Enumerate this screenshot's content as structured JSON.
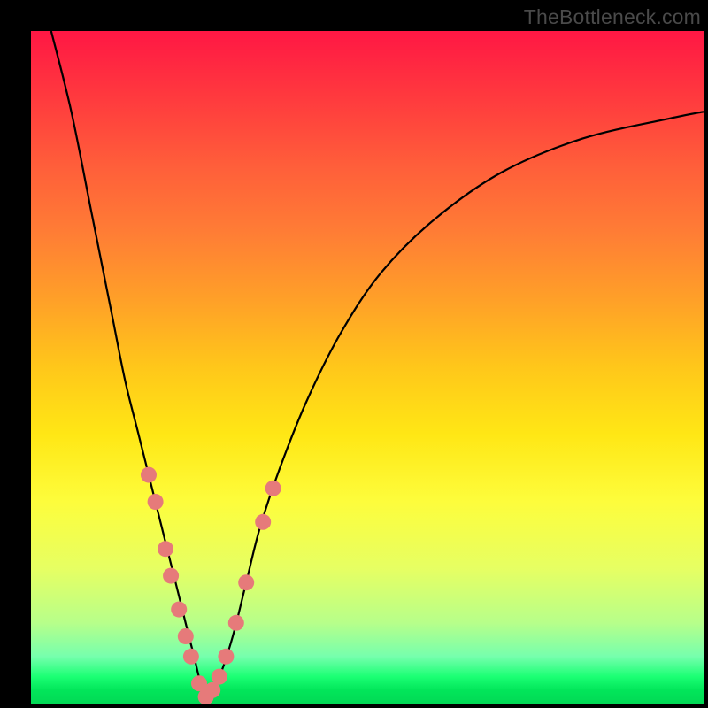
{
  "watermark": "TheBottleneck.com",
  "colors": {
    "frame": "#000000",
    "curve": "#000000",
    "dot": "#e67a7a",
    "gradient_top": "#ff1744",
    "gradient_bottom": "#02d955"
  },
  "chart_data": {
    "type": "line",
    "title": "",
    "xlabel": "",
    "ylabel": "",
    "xlim": [
      0,
      100
    ],
    "ylim": [
      0,
      100
    ],
    "note": "Bottleneck-style V-curve; y-axis = mismatch (% high=red top, 0=green bottom), x-axis = component balance. Minimum ~x=26. Pink dots mark sampled points along both flanks of the valley.",
    "series": [
      {
        "name": "bottleneck-curve",
        "x": [
          3,
          6,
          9,
          12,
          14,
          16,
          18,
          20,
          22,
          24,
          26,
          28,
          30,
          32,
          34,
          37,
          41,
          46,
          52,
          60,
          70,
          82,
          95,
          100
        ],
        "y": [
          100,
          88,
          73,
          58,
          48,
          40,
          32,
          24,
          16,
          8,
          1,
          4,
          10,
          18,
          26,
          35,
          45,
          55,
          64,
          72,
          79,
          84,
          87,
          88
        ]
      }
    ],
    "points": [
      {
        "x": 17.5,
        "y": 34
      },
      {
        "x": 18.5,
        "y": 30
      },
      {
        "x": 20.0,
        "y": 23
      },
      {
        "x": 20.8,
        "y": 19
      },
      {
        "x": 22.0,
        "y": 14
      },
      {
        "x": 23.0,
        "y": 10
      },
      {
        "x": 23.8,
        "y": 7
      },
      {
        "x": 25.0,
        "y": 3
      },
      {
        "x": 26.0,
        "y": 1
      },
      {
        "x": 27.0,
        "y": 2
      },
      {
        "x": 28.0,
        "y": 4
      },
      {
        "x": 29.0,
        "y": 7
      },
      {
        "x": 30.5,
        "y": 12
      },
      {
        "x": 32.0,
        "y": 18
      },
      {
        "x": 34.5,
        "y": 27
      },
      {
        "x": 36.0,
        "y": 32
      }
    ]
  }
}
